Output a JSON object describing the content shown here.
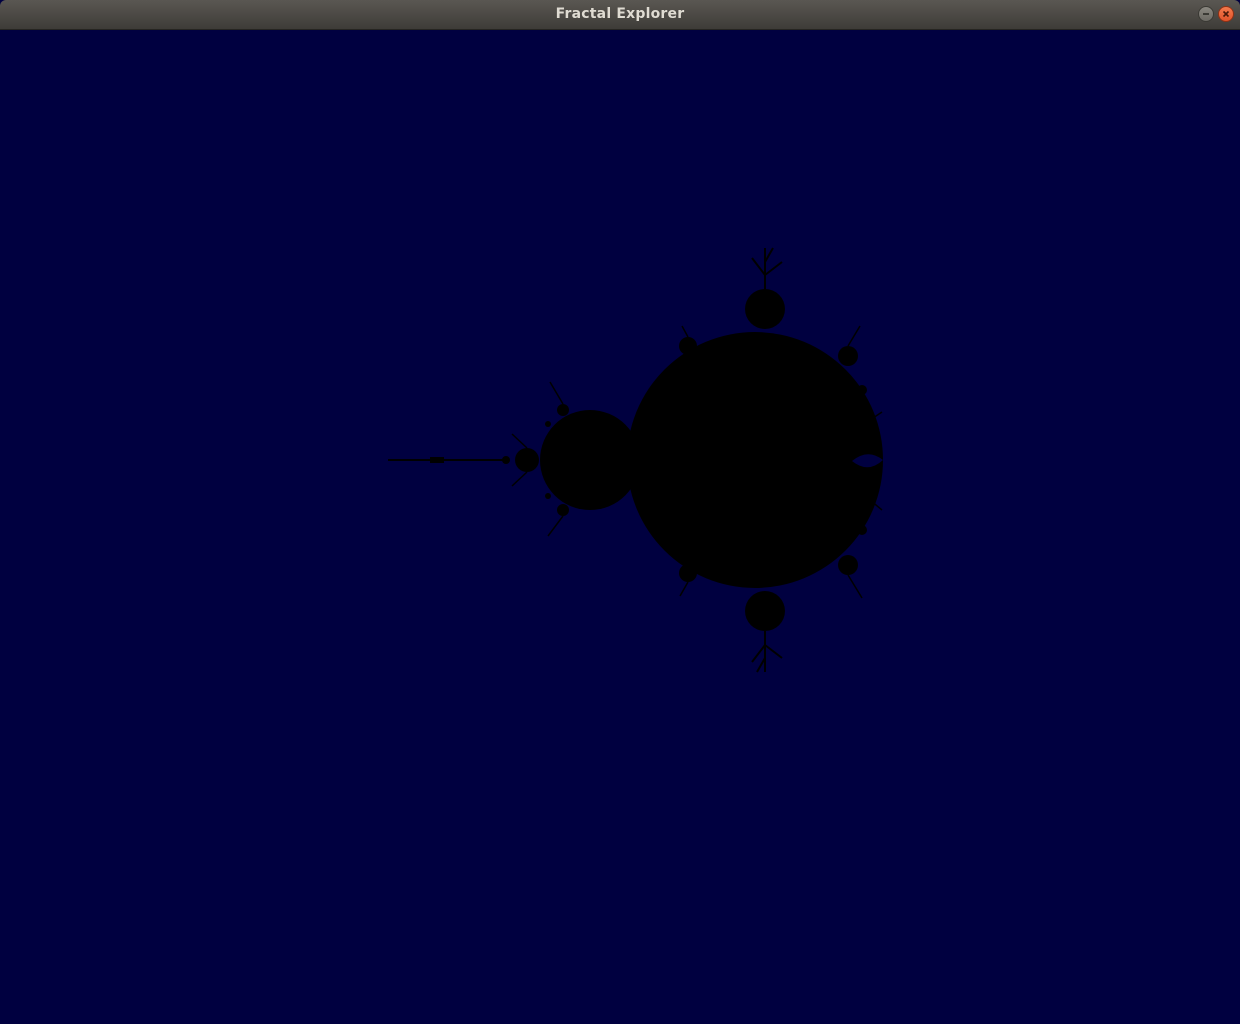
{
  "window": {
    "title": "Fractal Explorer",
    "controls": {
      "minimize_icon": "minimize-icon",
      "close_icon": "close-icon"
    }
  },
  "viewport": {
    "background_color": "#000040",
    "set_color": "#000000",
    "fractal": "mandelbrot-set"
  }
}
